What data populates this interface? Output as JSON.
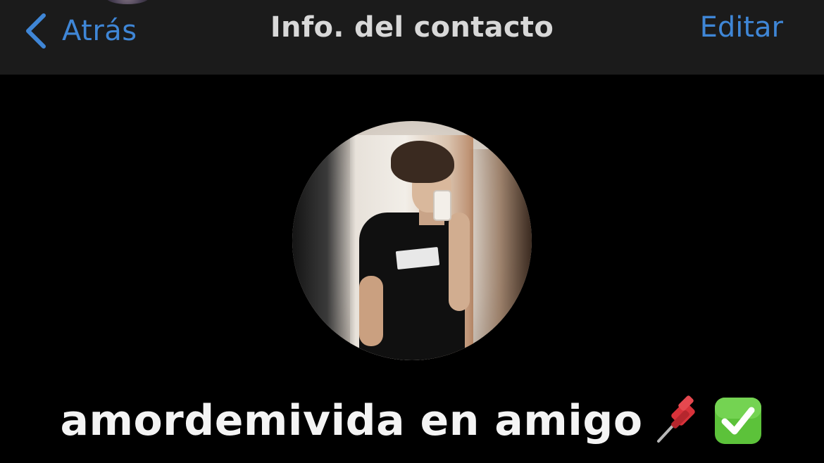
{
  "nav": {
    "back_label": "Atrás",
    "title": "Info. del contacto",
    "edit_label": "Editar"
  },
  "contact": {
    "name": "amordemivida en amigo",
    "emojis": [
      "pushpin-icon",
      "check-mark-button-icon"
    ]
  },
  "colors": {
    "accent": "#3f86d6",
    "nav_background": "#1b1b1b",
    "background": "#000000",
    "name_text": "#f4f4f4",
    "check_green": "#5cc23a"
  }
}
